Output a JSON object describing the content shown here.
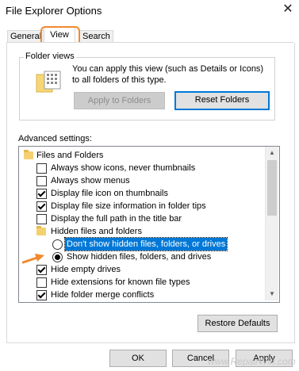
{
  "window": {
    "title": "File Explorer Options",
    "close_glyph": "✕"
  },
  "tabs": [
    {
      "label": "General"
    },
    {
      "label": "View"
    },
    {
      "label": "Search"
    }
  ],
  "folder_views": {
    "label": "Folder views",
    "description": "You can apply this view (such as Details or Icons) to all folders of this type.",
    "apply_button": "Apply to Folders",
    "reset_button": "Reset Folders"
  },
  "advanced": {
    "label": "Advanced settings:",
    "items": [
      {
        "type": "folder",
        "label": "Files and Folders"
      },
      {
        "type": "checkbox",
        "checked": false,
        "label": "Always show icons, never thumbnails"
      },
      {
        "type": "checkbox",
        "checked": false,
        "label": "Always show menus"
      },
      {
        "type": "checkbox",
        "checked": true,
        "label": "Display file icon on thumbnails"
      },
      {
        "type": "checkbox",
        "checked": true,
        "label": "Display file size information in folder tips"
      },
      {
        "type": "checkbox",
        "checked": false,
        "label": "Display the full path in the title bar"
      },
      {
        "type": "folder",
        "label": "Hidden files and folders"
      },
      {
        "type": "radio",
        "checked": false,
        "label": "Don't show hidden files, folders, or drives"
      },
      {
        "type": "radio",
        "checked": true,
        "label": "Show hidden files, folders, and drives"
      },
      {
        "type": "checkbox",
        "checked": true,
        "label": "Hide empty drives"
      },
      {
        "type": "checkbox",
        "checked": false,
        "label": "Hide extensions for known file types"
      },
      {
        "type": "checkbox",
        "checked": true,
        "label": "Hide folder merge conflicts"
      }
    ],
    "restore_button": "Restore Defaults"
  },
  "footer": {
    "ok": "OK",
    "cancel": "Cancel",
    "apply": "Apply"
  },
  "watermark": "www.RepairWin.com",
  "colors": {
    "highlight": "#0078d7",
    "annotation": "#f08a2e"
  }
}
